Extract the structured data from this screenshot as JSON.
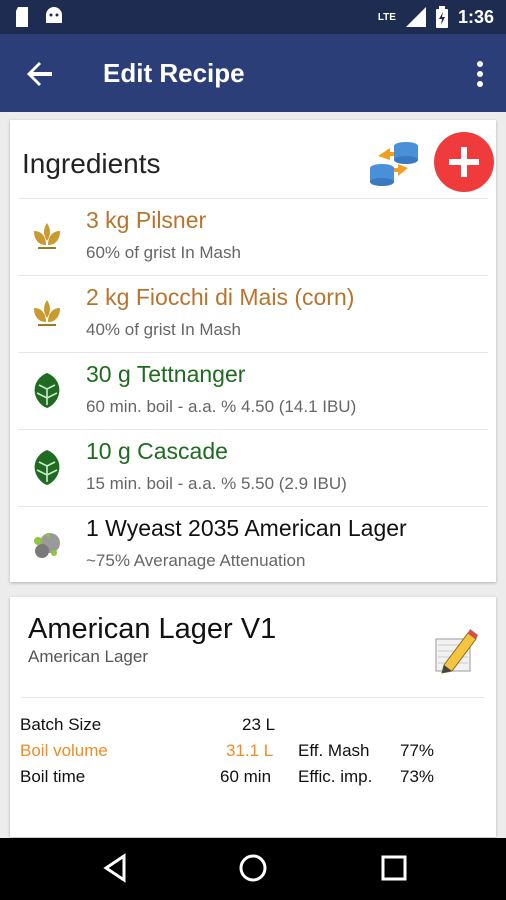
{
  "status_bar": {
    "time": "1:36",
    "network": "LTE",
    "icons": [
      "sd-card-icon",
      "android-icon",
      "signal-icon",
      "battery-charging-icon"
    ]
  },
  "app_bar": {
    "title": "Edit Recipe",
    "back_icon": "arrow-back-icon",
    "menu_icon": "more-vertical-icon",
    "background": "#2c3e78"
  },
  "ingredients": {
    "title": "Ingredients",
    "add_color": "#ef3b3b",
    "items": [
      {
        "name": "3 kg Pilsner",
        "detail": "60% of grist In Mash",
        "type": "grain",
        "color": "#b8742c"
      },
      {
        "name": "2 kg Fiocchi di Mais (corn)",
        "detail": "40% of grist In Mash",
        "type": "grain",
        "color": "#b8742c"
      },
      {
        "name": "30 g Tettnanger",
        "detail": "60 min. boil - a.a. % 4.50 (14.1 IBU)",
        "type": "hop",
        "color": "#1e6b1e"
      },
      {
        "name": "10 g Cascade",
        "detail": "15 min. boil - a.a. % 5.50 (2.9 IBU)",
        "type": "hop",
        "color": "#1e6b1e"
      },
      {
        "name": "1 Wyeast 2035 American Lager",
        "detail": "~75% Averanage Attenuation",
        "type": "yeast",
        "color": "#111111"
      }
    ]
  },
  "recipe": {
    "name": "American Lager V1",
    "style": "American Lager",
    "batch_size_label": "Batch Size",
    "batch_size_value": "23 L",
    "boil_volume_label": "Boil volume",
    "boil_volume_value": "31.1 L",
    "boil_time_label": "Boil time",
    "boil_time_value": "60 min",
    "eff_mash_label": "Eff. Mash",
    "eff_mash_value": "77%",
    "effic_imp_label": "Effic. imp.",
    "effic_imp_value": "73%",
    "highlight_color": "#f08c22"
  },
  "nav_bar": {
    "icons": [
      "back-triangle-icon",
      "home-circle-icon",
      "recents-square-icon"
    ]
  }
}
